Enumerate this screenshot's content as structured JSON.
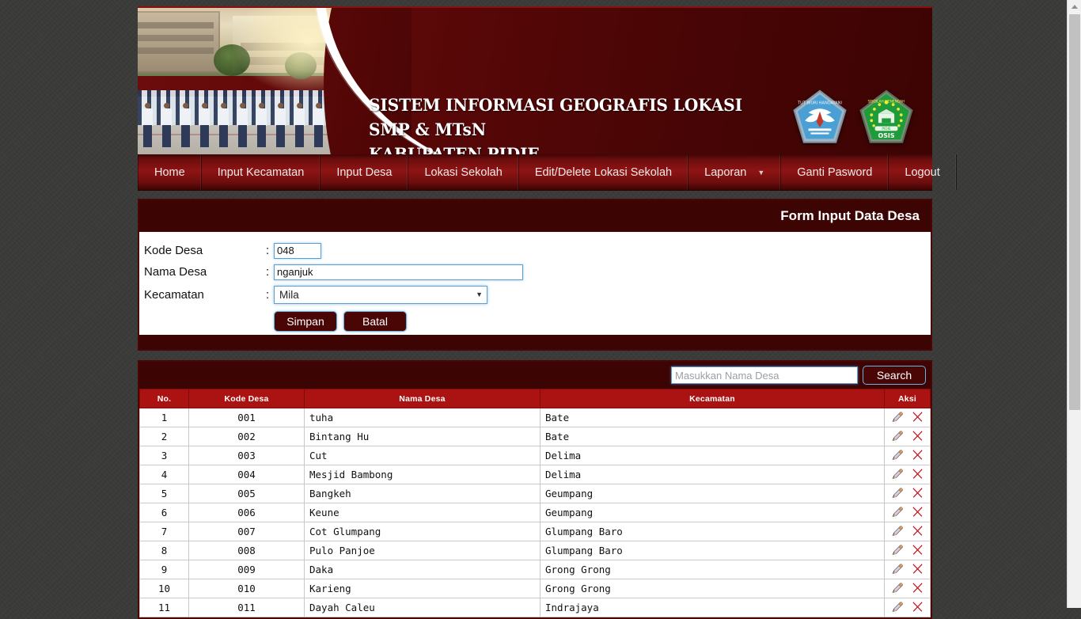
{
  "site": {
    "title_line1": "SISTEM INFORMASI GEOGRAFIS LOKASI SMP & MTsN",
    "title_line2": "KABUPATEN PIDIE",
    "logo_left_name": "tut-wuri-handayani-logo",
    "logo_right_name": "osis-logo",
    "banner_photo_alt": "students-lined-up-schoolyard-photo",
    "accent_dark": "#3d0404",
    "accent_maroon": "#4a0505",
    "accent_red": "#ab1212",
    "nav_gradient_mid": "#8f1414",
    "page_background": "#3a3a38"
  },
  "nav": {
    "items": [
      {
        "label": "Home",
        "has_caret": false
      },
      {
        "label": "Input Kecamatan",
        "has_caret": false
      },
      {
        "label": "Input Desa",
        "has_caret": false
      },
      {
        "label": "Lokasi Sekolah",
        "has_caret": false
      },
      {
        "label": "Edit/Delete Lokasi Sekolah",
        "has_caret": false
      },
      {
        "label": "Laporan",
        "has_caret": true,
        "caret": "▼"
      },
      {
        "label": "Ganti Pasword",
        "has_caret": false
      },
      {
        "label": "Logout",
        "has_caret": false
      }
    ]
  },
  "form": {
    "title": "Form Input Data Desa",
    "fields": [
      {
        "label": "Kode Desa",
        "colon": ":",
        "value": "048",
        "placeholder": ""
      },
      {
        "label": "Nama Desa",
        "colon": ":",
        "value": "nganjuk",
        "placeholder": ""
      },
      {
        "label": "Kecamatan",
        "colon": ":",
        "value": "Mila",
        "placeholder": ""
      }
    ],
    "select_arrow": "▼",
    "save_label": "Simpan",
    "cancel_label": "Batal"
  },
  "search": {
    "placeholder": "Masukkan Nama Desa",
    "value": "",
    "button_label": "Search"
  },
  "table": {
    "columns": [
      "No.",
      "Kode Desa",
      "Nama Desa",
      "Kecamatan",
      "Aksi"
    ],
    "edit_icon_name": "pencil-edit-icon",
    "delete_icon_name": "red-x-delete-icon",
    "rows": [
      {
        "no": "1",
        "kode": "001",
        "nama": "tuha",
        "kecamatan": "Bate"
      },
      {
        "no": "2",
        "kode": "002",
        "nama": "Bintang Hu",
        "kecamatan": "Bate"
      },
      {
        "no": "3",
        "kode": "003",
        "nama": "Cut",
        "kecamatan": "Delima"
      },
      {
        "no": "4",
        "kode": "004",
        "nama": "Mesjid Bambong",
        "kecamatan": "Delima"
      },
      {
        "no": "5",
        "kode": "005",
        "nama": "Bangkeh",
        "kecamatan": "Geumpang"
      },
      {
        "no": "6",
        "kode": "006",
        "nama": "Keune",
        "kecamatan": "Geumpang"
      },
      {
        "no": "7",
        "kode": "007",
        "nama": "Cot Glumpang",
        "kecamatan": "Glumpang Baro"
      },
      {
        "no": "8",
        "kode": "008",
        "nama": "Pulo Panjoe",
        "kecamatan": "Glumpang Baro"
      },
      {
        "no": "9",
        "kode": "009",
        "nama": "Daka",
        "kecamatan": "Grong Grong"
      },
      {
        "no": "10",
        "kode": "010",
        "nama": "Karieng",
        "kecamatan": "Grong Grong"
      },
      {
        "no": "11",
        "kode": "011",
        "nama": "Dayah Caleu",
        "kecamatan": "Indrajaya"
      }
    ]
  }
}
